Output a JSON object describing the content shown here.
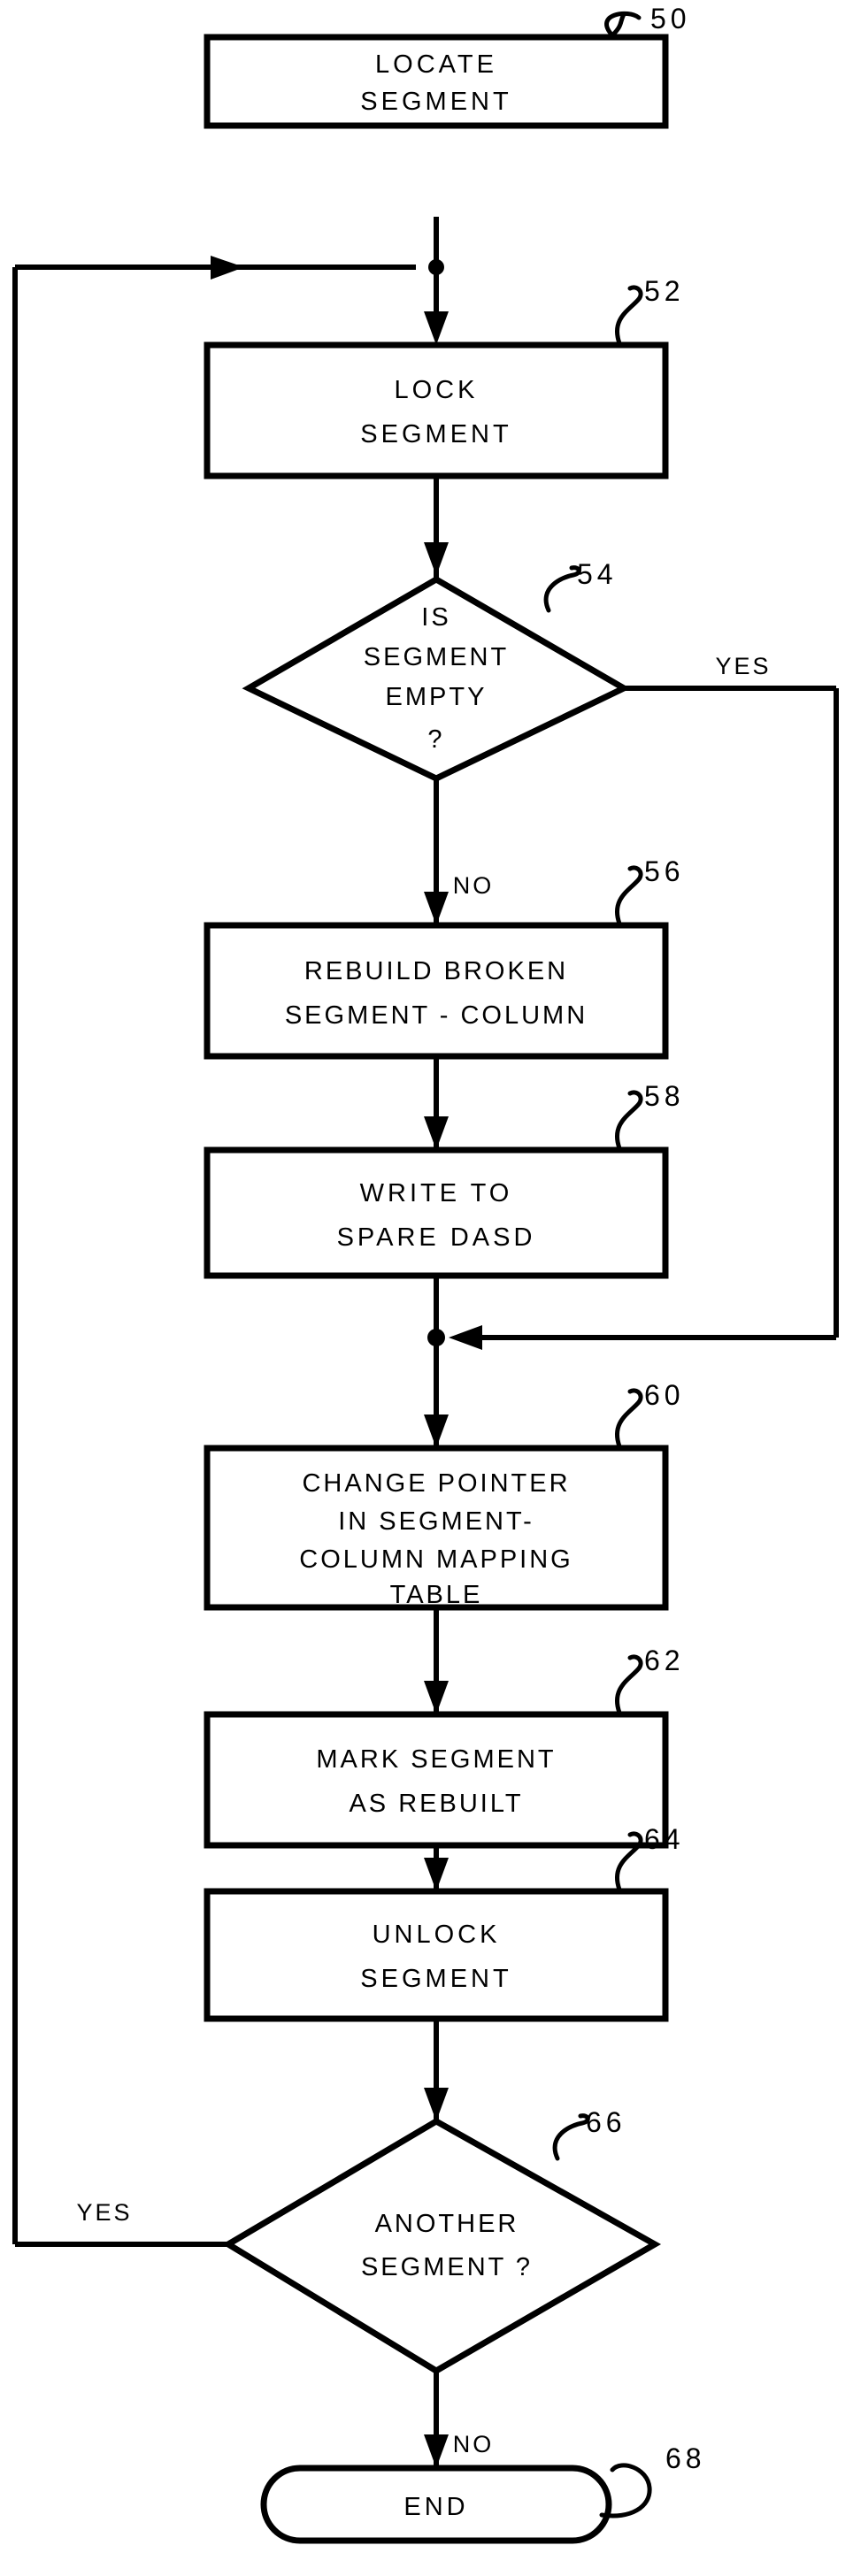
{
  "figure": {
    "kind": "patent-flowchart",
    "ink_color": "#000000",
    "background_color": "#ffffff"
  },
  "nodes": [
    {
      "id": "n50",
      "ref": "50",
      "shape": "process",
      "lines": [
        "LOCATE",
        "SEGMENT"
      ]
    },
    {
      "id": "n52",
      "ref": "52",
      "shape": "process",
      "lines": [
        "LOCK",
        "SEGMENT"
      ]
    },
    {
      "id": "n54",
      "ref": "54",
      "shape": "decision",
      "lines": [
        "IS",
        "SEGMENT",
        "EMPTY",
        "?"
      ]
    },
    {
      "id": "n56",
      "ref": "56",
      "shape": "process",
      "lines": [
        "REBUILD BROKEN",
        "SEGMENT - COLUMN"
      ]
    },
    {
      "id": "n58",
      "ref": "58",
      "shape": "process",
      "lines": [
        "WRITE TO",
        "SPARE DASD"
      ]
    },
    {
      "id": "n60",
      "ref": "60",
      "shape": "process",
      "lines": [
        "CHANGE POINTER",
        "IN SEGMENT-",
        "COLUMN MAPPING",
        "TABLE"
      ]
    },
    {
      "id": "n62",
      "ref": "62",
      "shape": "process",
      "lines": [
        "MARK SEGMENT",
        "AS REBUILT"
      ]
    },
    {
      "id": "n64",
      "ref": "64",
      "shape": "process",
      "lines": [
        "UNLOCK",
        "SEGMENT"
      ]
    },
    {
      "id": "n66",
      "ref": "66",
      "shape": "decision",
      "lines": [
        "ANOTHER",
        "SEGMENT ?"
      ]
    },
    {
      "id": "n68",
      "ref": "68",
      "shape": "terminator",
      "lines": [
        "END"
      ]
    }
  ],
  "edge_labels": {
    "d54_yes": "YES",
    "d54_no": "NO",
    "d66_yes": "YES",
    "d66_no": "NO"
  },
  "ref_labels": {
    "r50": "50",
    "r52": "52",
    "r54": "54",
    "r56": "56",
    "r58": "58",
    "r60": "60",
    "r62": "62",
    "r64": "64",
    "r66": "66",
    "r68": "68"
  }
}
